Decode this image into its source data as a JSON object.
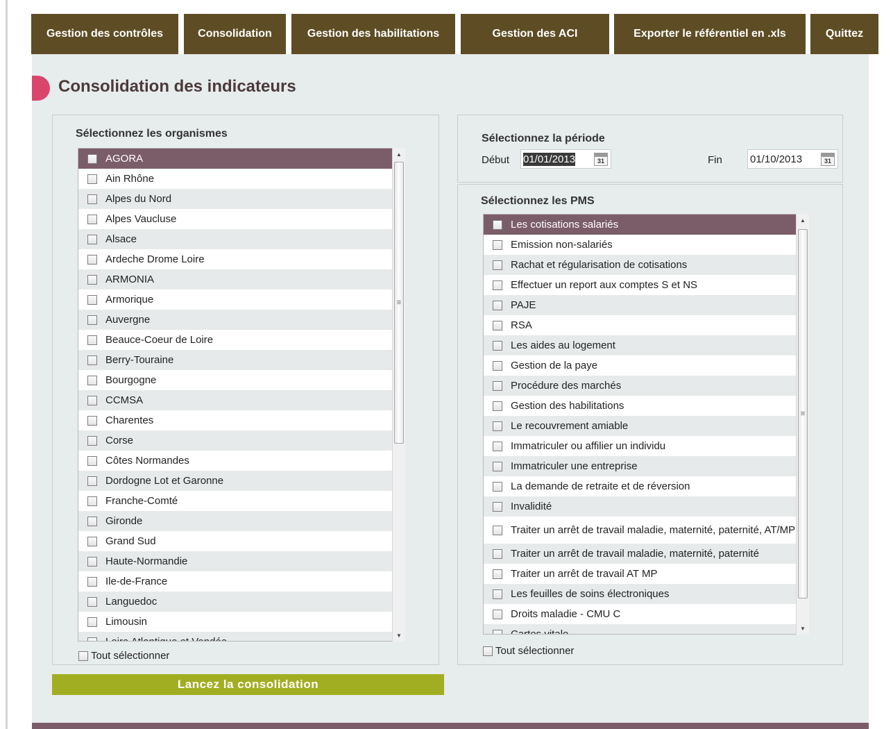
{
  "nav": {
    "tabs": [
      "Gestion des contrôles",
      "Consolidation",
      "Gestion des habilitations",
      "Gestion des ACI",
      "Exporter le référentiel en .xls",
      "Quittez"
    ]
  },
  "page": {
    "title": "Consolidation des indicateurs"
  },
  "organismes": {
    "title": "Sélectionnez les organismes",
    "items": [
      "AGORA",
      "Ain Rhône",
      "Alpes du Nord",
      "Alpes Vaucluse",
      "Alsace",
      "Ardeche Drome Loire",
      "ARMONIA",
      "Armorique",
      "Auvergne",
      "Beauce-Coeur de Loire",
      "Berry-Touraine",
      "Bourgogne",
      "CCMSA",
      "Charentes",
      "Corse",
      "Côtes Normandes",
      "Dordogne Lot et Garonne",
      "Franche-Comté",
      "Gironde",
      "Grand Sud",
      "Haute-Normandie",
      "Ile-de-France",
      "Languedoc",
      "Limousin",
      "Loire Atlantique et Vendée"
    ],
    "select_all": "Tout sélectionner"
  },
  "periode": {
    "title": "Sélectionnez la période",
    "debut_label": "Début",
    "debut_value": "01/01/2013",
    "fin_label": "Fin",
    "fin_value": "01/10/2013",
    "calendar_text": "31"
  },
  "pms": {
    "title": "Sélectionnez les PMS",
    "items": [
      "Les cotisations salariés",
      "Emission non-salariés",
      "Rachat et régularisation de cotisations",
      "Effectuer un report aux comptes S et NS",
      "PAJE",
      "RSA",
      "Les aides au logement",
      "Gestion de la paye",
      "Procédure des marchés",
      "Gestion des habilitations",
      "Le recouvrement amiable",
      "Immatriculer ou affilier un individu",
      "Immatriculer une entreprise",
      "La demande de retraite et de réversion",
      "Invalidité",
      "Traiter un arrêt de travail maladie, maternité, paternité, AT/MP",
      "Traiter un arrêt de travail maladie, maternité, paternité",
      "Traiter un arrêt de travail AT MP",
      "Les feuilles de soins électroniques",
      "Droits maladie - CMU C",
      "Cartes vitale"
    ],
    "select_all": "Tout sélectionner"
  },
  "actions": {
    "launch": "Lancez la consolidation"
  },
  "colors": {
    "nav_bg": "#5e4d24",
    "selected_row": "#7b5d69",
    "accent_dot": "#d9456b",
    "launch_button": "#a2ae22",
    "content_bg": "#e7eced"
  }
}
